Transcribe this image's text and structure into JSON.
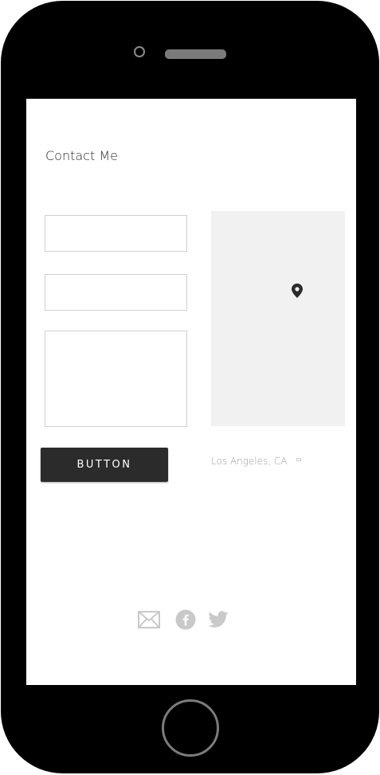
{
  "contact": {
    "title": "Contact Me",
    "name_field": {
      "value": "",
      "placeholder": ""
    },
    "email_field": {
      "value": "",
      "placeholder": ""
    },
    "message_field": {
      "value": "",
      "placeholder": ""
    },
    "button_label": "BUTTON"
  },
  "map": {
    "pin_icon": "map-pin-icon",
    "location": "Los Angeles, CA"
  },
  "social": [
    {
      "icon": "mail-icon"
    },
    {
      "icon": "facebook-icon"
    },
    {
      "icon": "twitter-icon"
    }
  ],
  "colors": {
    "button_background": "#2b2b2b",
    "map_background": "#f1f1f1",
    "field_border": "#cfcfcf",
    "social_icon": "#c9c9c9"
  }
}
